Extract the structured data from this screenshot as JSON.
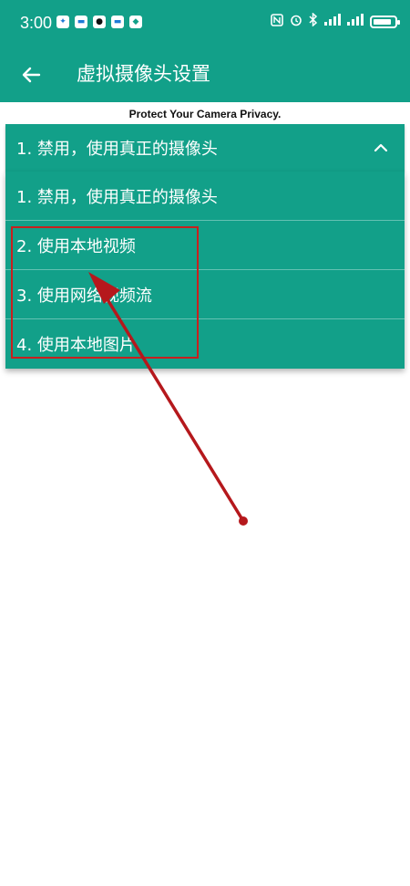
{
  "status_bar": {
    "time": "3:00",
    "app_icons": [
      "app-icon-a",
      "message-icon",
      "qq-icon",
      "message-icon",
      "shield-app-icon"
    ],
    "right_icons": [
      "nfc-icon",
      "alarm-icon",
      "bluetooth-icon",
      "signal-icon",
      "wifi-icon"
    ],
    "battery_level": 0.85
  },
  "app_bar": {
    "title": "虚拟摄像头设置",
    "back_icon": "arrow-left-icon"
  },
  "privacy_text": "Protect Your Camera Privacy.",
  "select": {
    "selected": "1. 禁用，使用真正的摄像头",
    "expanded": true,
    "options": [
      "1. 禁用，使用真正的摄像头",
      "2. 使用本地视频",
      "3. 使用网络视频流",
      "4. 使用本地图片"
    ]
  },
  "colors": {
    "primary": "#12a089",
    "annotation": "#c8201e"
  }
}
